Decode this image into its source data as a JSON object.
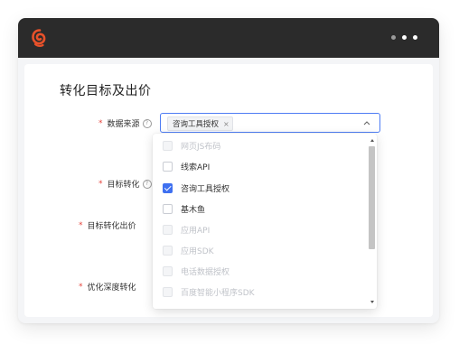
{
  "window": {
    "logo_icon": "brand-spiral-icon",
    "menu_icon": "more-dots-icon",
    "accent": "#e8512a"
  },
  "card": {
    "title": "转化目标及出价",
    "fields": {
      "source_label": "数据来源",
      "target_label": "目标转化",
      "bid_label": "目标转化出价",
      "deep_label": "优化深度转化",
      "help_glyph": "?",
      "required_mark": "*"
    },
    "select": {
      "selected_tag": "咨询工具授权",
      "tag_close": "×"
    },
    "dropdown": {
      "options": [
        {
          "label": "网页JS布码",
          "checked": false,
          "disabled": true
        },
        {
          "label": "线索API",
          "checked": false,
          "disabled": false
        },
        {
          "label": "咨询工具授权",
          "checked": true,
          "disabled": false
        },
        {
          "label": "基木鱼",
          "checked": false,
          "disabled": false
        },
        {
          "label": "应用API",
          "checked": false,
          "disabled": true
        },
        {
          "label": "应用SDK",
          "checked": false,
          "disabled": true
        },
        {
          "label": "电话数据授权",
          "checked": false,
          "disabled": true
        },
        {
          "label": "百度智能小程序SDK",
          "checked": false,
          "disabled": true
        }
      ]
    }
  },
  "colors": {
    "primary": "#3f70f0",
    "required": "#e5443c",
    "titlebar": "#2b2b2b"
  }
}
